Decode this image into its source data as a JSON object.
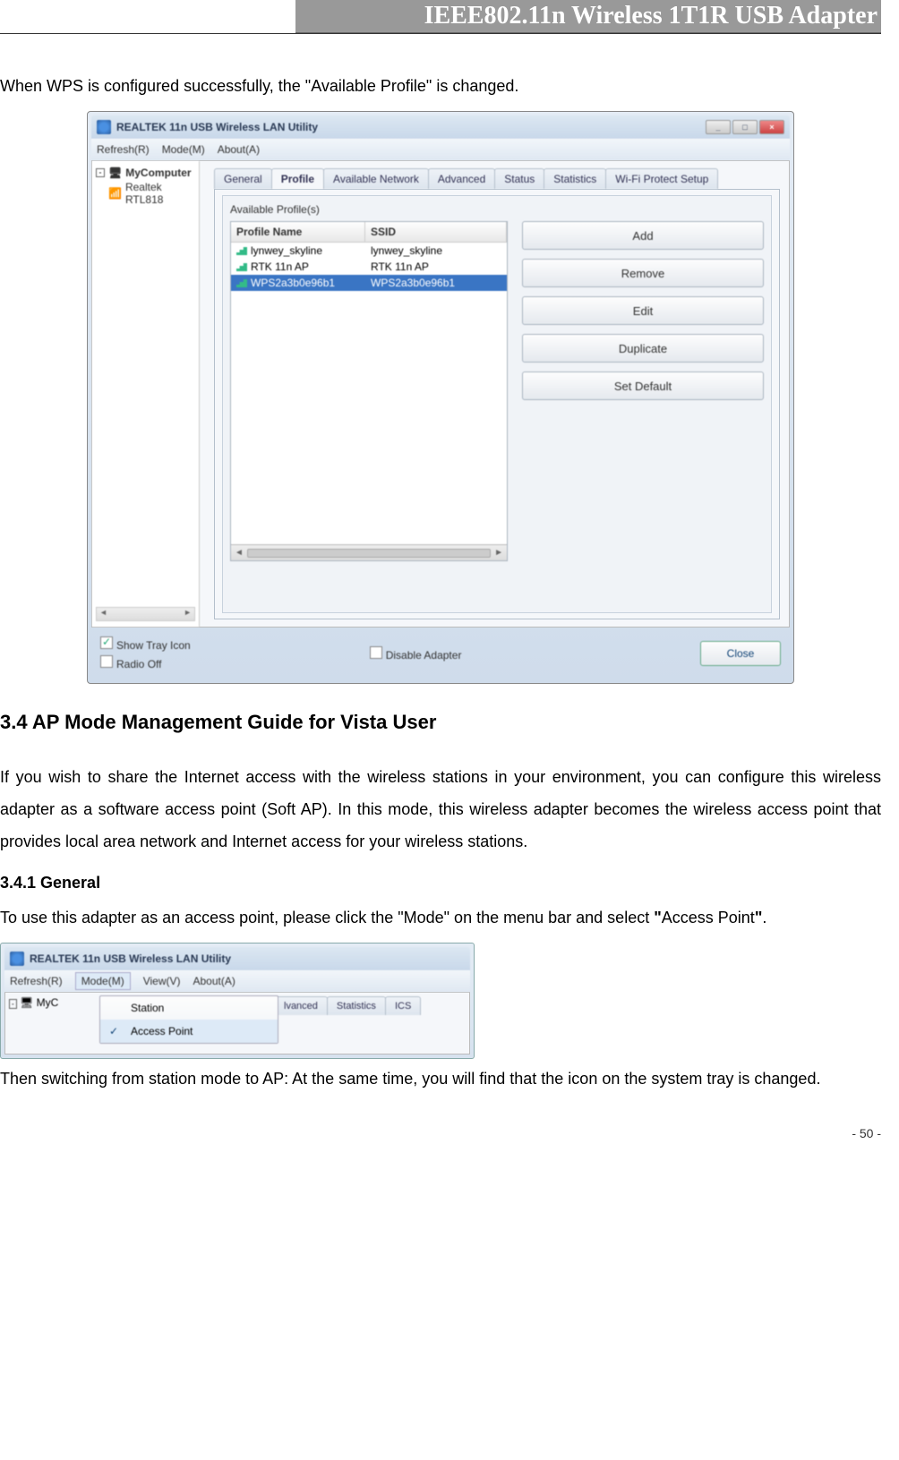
{
  "header": {
    "title": "IEEE802.11n Wireless 1T1R USB Adapter"
  },
  "intro_text": "When WPS is configured successfully, the \"Available Profile\" is changed.",
  "screenshot1": {
    "window_title": "REALTEK 11n USB Wireless LAN Utility",
    "menus": {
      "refresh": "Refresh(R)",
      "mode": "Mode(M)",
      "about": "About(A)"
    },
    "tree": {
      "root": "MyComputer",
      "child": "Realtek RTL818"
    },
    "tabs": [
      "General",
      "Profile",
      "Available Network",
      "Advanced",
      "Status",
      "Statistics",
      "Wi-Fi Protect Setup"
    ],
    "active_tab_index": 1,
    "panel_title": "Available Profile(s)",
    "columns": {
      "name": "Profile Name",
      "ssid": "SSID"
    },
    "rows": [
      {
        "name": "lynwey_skyline",
        "ssid": "lynwey_skyline",
        "selected": false
      },
      {
        "name": "RTK 11n AP",
        "ssid": "RTK 11n AP",
        "selected": false
      },
      {
        "name": "WPS2a3b0e96b1",
        "ssid": "WPS2a3b0e96b1",
        "selected": true
      }
    ],
    "buttons": {
      "add": "Add",
      "remove": "Remove",
      "edit": "Edit",
      "duplicate": "Duplicate",
      "set_default": "Set Default"
    },
    "footer": {
      "show_tray": "Show Tray Icon",
      "radio_off": "Radio Off",
      "disable_adapter": "Disable Adapter",
      "close": "Close"
    }
  },
  "section34": {
    "heading": "3.4    AP Mode Management Guide for Vista User",
    "para": "If you wish to share the Internet access with the wireless stations in your environment, you can configure this wireless adapter as a software access point (Soft AP). In this mode, this wireless adapter becomes the wireless access point that provides local area network and Internet access for your wireless stations."
  },
  "section341": {
    "heading": "3.4.1    General",
    "para_pre": "To use this adapter as an access point, please click the \"Mode\" on the menu bar and select ",
    "bold_open": "\"",
    "bold_word": "Access Point",
    "bold_close": "\"",
    "para_post": "."
  },
  "screenshot2": {
    "window_title": "REALTEK 11n USB Wireless LAN Utility",
    "menus": {
      "refresh": "Refresh(R)",
      "mode": "Mode(M)",
      "view": "View(V)",
      "about": "About(A)"
    },
    "tree_root": "MyC",
    "tabs_visible": [
      "lvanced",
      "Statistics",
      "ICS"
    ],
    "dropdown": {
      "station": "Station",
      "ap": "Access Point"
    }
  },
  "closing_text": "Then switching from station mode to AP: At the same time, you will find that the icon on the system tray is changed.",
  "page_number": "- 50 -"
}
